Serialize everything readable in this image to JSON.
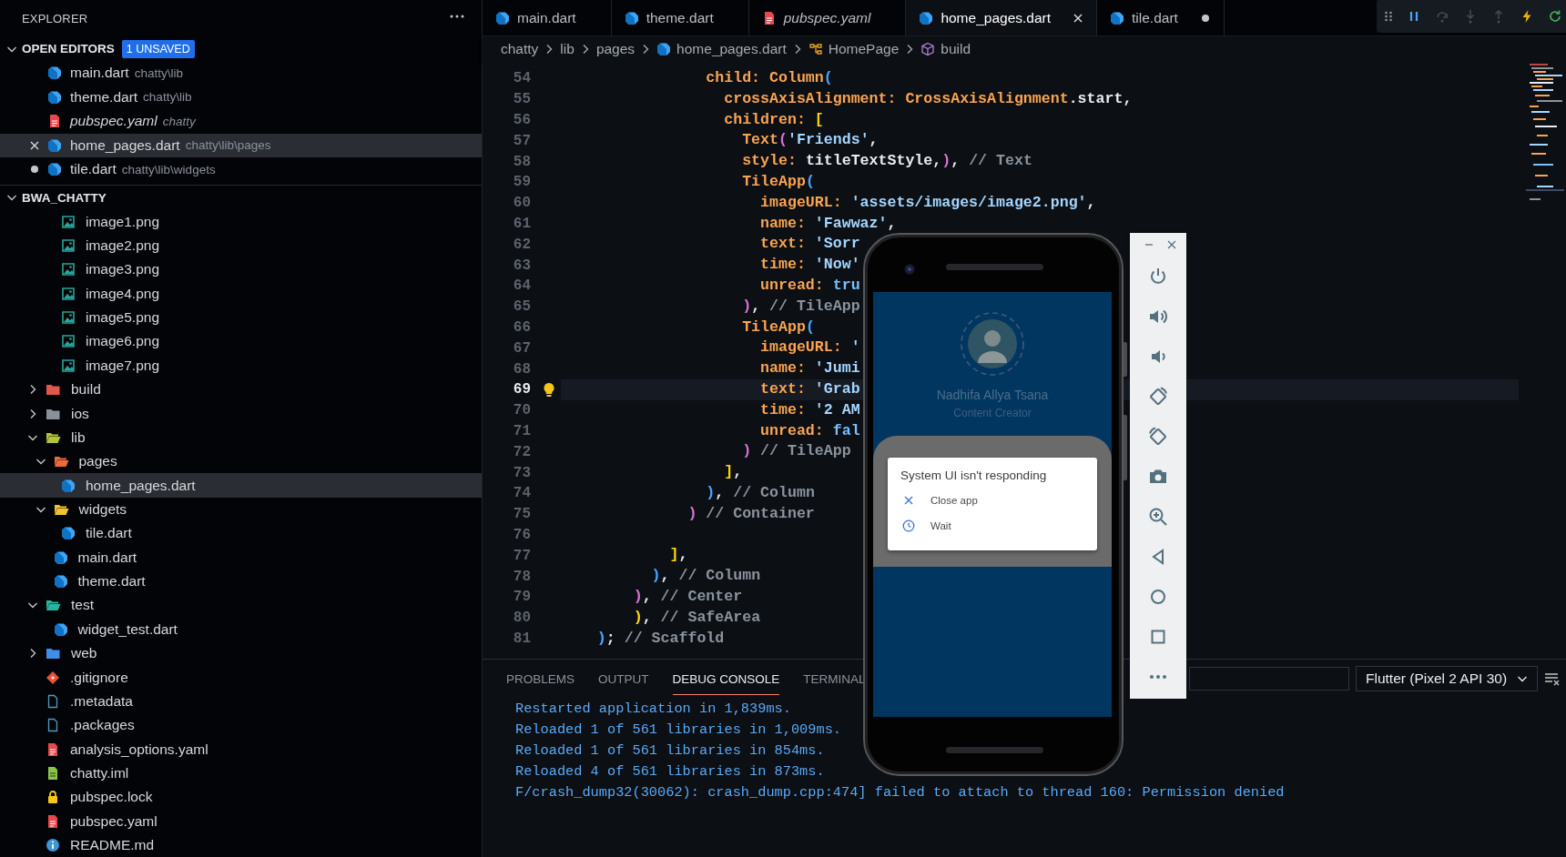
{
  "editor_tabs": [
    {
      "label": "main.dart",
      "kind": "dart",
      "selected": false,
      "preview": false,
      "dirty": false
    },
    {
      "label": "theme.dart",
      "kind": "dart",
      "selected": false,
      "preview": false,
      "dirty": false
    },
    {
      "label": "pubspec.yaml",
      "kind": "yaml",
      "selected": false,
      "preview": true,
      "dirty": false
    },
    {
      "label": "home_pages.dart",
      "kind": "dart",
      "selected": true,
      "preview": false,
      "dirty": false
    },
    {
      "label": "tile.dart",
      "kind": "dart",
      "selected": false,
      "preview": false,
      "dirty": true
    }
  ],
  "debug_toolbar": {
    "buttons": [
      {
        "disabled": false
      },
      {
        "disabled": true
      },
      {
        "disabled": true
      },
      {
        "disabled": true
      },
      {
        "disabled": false
      },
      {
        "disabled": false
      }
    ]
  },
  "explorer": {
    "title": "EXPLORER",
    "open_editors": {
      "title": "OPEN EDITORS",
      "badge": "1 UNSAVED",
      "expanded": true,
      "items": [
        {
          "name": "main.dart",
          "path": "chatty\\lib",
          "kind": "dart",
          "selected": false,
          "preview": false,
          "dirty": false
        },
        {
          "name": "theme.dart",
          "path": "chatty\\lib",
          "kind": "dart",
          "selected": false,
          "preview": false,
          "dirty": false
        },
        {
          "name": "pubspec.yaml",
          "path": "chatty",
          "kind": "yaml",
          "selected": false,
          "preview": true,
          "dirty": false
        },
        {
          "name": "home_pages.dart",
          "path": "chatty\\lib\\pages",
          "kind": "dart",
          "selected": true,
          "preview": false,
          "dirty": false
        },
        {
          "name": "tile.dart",
          "path": "chatty\\lib\\widgets",
          "kind": "dart",
          "selected": false,
          "preview": false,
          "dirty": true
        }
      ]
    },
    "project": {
      "title": "BWA_CHATTY",
      "expanded": true,
      "tree": [
        {
          "children": [
            {
              "children": [
                {
                  "name": "image1.png",
                  "kind": "image",
                  "selected": false
                },
                {
                  "name": "image2.png",
                  "kind": "image",
                  "selected": false
                },
                {
                  "name": "image3.png",
                  "kind": "image",
                  "selected": false
                },
                {
                  "name": "image4.png",
                  "kind": "image",
                  "selected": false
                },
                {
                  "name": "image5.png",
                  "kind": "image",
                  "selected": false
                },
                {
                  "name": "image6.png",
                  "kind": "image",
                  "selected": false
                },
                {
                  "name": "image7.png",
                  "kind": "image",
                  "selected": false
                }
              ]
            }
          ]
        },
        {
          "name": "build",
          "kind": "folder",
          "color": "#e2574c",
          "expanded": false,
          "selected": false
        },
        {
          "name": "ios",
          "kind": "folder",
          "color": "#8a9099",
          "expanded": false,
          "selected": false
        },
        {
          "name": "lib",
          "kind": "folder",
          "color": "#b4c43a",
          "expanded": true,
          "selected": false,
          "children": [
            {
              "name": "pages",
              "kind": "folder",
              "color": "#ee6a3c",
              "expanded": true,
              "selected": false,
              "children": [
                {
                  "name": "home_pages.dart",
                  "kind": "dart",
                  "selected": true
                }
              ]
            },
            {
              "name": "widgets",
              "kind": "folder",
              "color": "#f2c230",
              "expanded": true,
              "selected": false,
              "children": [
                {
                  "name": "tile.dart",
                  "kind": "dart",
                  "selected": false
                }
              ]
            },
            {
              "name": "main.dart",
              "kind": "dart",
              "selected": false
            },
            {
              "name": "theme.dart",
              "kind": "dart",
              "selected": false
            }
          ]
        },
        {
          "name": "test",
          "kind": "folder",
          "color": "#26b59e",
          "expanded": true,
          "selected": false,
          "children": [
            {
              "name": "widget_test.dart",
              "kind": "dart",
              "selected": false
            }
          ]
        },
        {
          "name": "web",
          "kind": "folder",
          "color": "#3d8fe8",
          "expanded": false,
          "selected": false
        },
        {
          "name": ".gitignore",
          "kind": "git",
          "selected": false
        },
        {
          "name": ".metadata",
          "kind": "file",
          "selected": false
        },
        {
          "name": ".packages",
          "kind": "file",
          "selected": false
        },
        {
          "name": "analysis_options.yaml",
          "kind": "yaml",
          "selected": false
        },
        {
          "name": "chatty.iml",
          "kind": "iml",
          "selected": false
        },
        {
          "name": "pubspec.lock",
          "kind": "lock",
          "selected": false
        },
        {
          "name": "pubspec.yaml",
          "kind": "yaml",
          "selected": false
        },
        {
          "name": "README.md",
          "kind": "info",
          "selected": false
        }
      ]
    }
  },
  "breadcrumb": [
    {
      "label": "chatty"
    },
    {
      "label": "lib"
    },
    {
      "label": "pages"
    },
    {
      "label": "home_pages.dart",
      "kind": "dart"
    },
    {
      "label": "HomePage",
      "kind": "class"
    },
    {
      "label": "build",
      "kind": "method"
    }
  ],
  "code_lines": [
    {
      "number": "54",
      "current": false,
      "tokens": [
        {
          "kind": "k",
          "text": "                child: Column"
        },
        {
          "kind": "b",
          "text": "("
        }
      ]
    },
    {
      "number": "55",
      "current": false,
      "tokens": [
        {
          "kind": "k",
          "text": "                  crossAxisAlignment: CrossAxisAlignment"
        },
        {
          "kind": "t",
          "text": ".start,"
        }
      ]
    },
    {
      "number": "56",
      "current": false,
      "tokens": [
        {
          "kind": "k",
          "text": "                  children: "
        },
        {
          "kind": "y",
          "text": "["
        }
      ]
    },
    {
      "number": "57",
      "current": false,
      "tokens": [
        {
          "kind": "k",
          "text": "                    Text"
        },
        {
          "kind": "m",
          "text": "("
        },
        {
          "kind": "s",
          "text": "'Friends'"
        },
        {
          "kind": "t",
          "text": ","
        }
      ]
    },
    {
      "number": "58",
      "current": false,
      "tokens": [
        {
          "kind": "k",
          "text": "                    style: "
        },
        {
          "kind": "t",
          "text": "titleTextStyle,"
        },
        {
          "kind": "m",
          "text": ")"
        },
        {
          "kind": "t",
          "text": ","
        },
        {
          "kind": "c",
          "text": " // Text"
        }
      ]
    },
    {
      "number": "59",
      "current": false,
      "tokens": [
        {
          "kind": "k",
          "text": "                    TileApp"
        },
        {
          "kind": "b",
          "text": "("
        }
      ]
    },
    {
      "number": "60",
      "current": false,
      "tokens": [
        {
          "kind": "k",
          "text": "                      imageURL: "
        },
        {
          "kind": "s",
          "text": "'assets/images/image2.png'"
        },
        {
          "kind": "t",
          "text": ","
        }
      ]
    },
    {
      "number": "61",
      "current": false,
      "tokens": [
        {
          "kind": "k",
          "text": "                      name: "
        },
        {
          "kind": "s",
          "text": "'Fawwaz'"
        },
        {
          "kind": "t",
          "text": ","
        }
      ]
    },
    {
      "number": "62",
      "current": false,
      "tokens": [
        {
          "kind": "k",
          "text": "                      text: "
        },
        {
          "kind": "s",
          "text": "'Sorr"
        }
      ]
    },
    {
      "number": "63",
      "current": false,
      "tokens": [
        {
          "kind": "k",
          "text": "                      time: "
        },
        {
          "kind": "s",
          "text": "'Now'"
        }
      ]
    },
    {
      "number": "64",
      "current": false,
      "tokens": [
        {
          "kind": "k",
          "text": "                      unread: "
        },
        {
          "kind": "l",
          "text": "tru"
        }
      ]
    },
    {
      "number": "65",
      "current": false,
      "tokens": [
        {
          "kind": "m",
          "text": "                    )"
        },
        {
          "kind": "t",
          "text": ","
        },
        {
          "kind": "c",
          "text": " // TileApp"
        }
      ]
    },
    {
      "number": "66",
      "current": false,
      "tokens": [
        {
          "kind": "k",
          "text": "                    TileApp"
        },
        {
          "kind": "b",
          "text": "("
        }
      ]
    },
    {
      "number": "67",
      "current": false,
      "tokens": [
        {
          "kind": "k",
          "text": "                      imageURL: "
        },
        {
          "kind": "s",
          "text": "'"
        }
      ]
    },
    {
      "number": "68",
      "current": false,
      "tokens": [
        {
          "kind": "k",
          "text": "                      name: "
        },
        {
          "kind": "s",
          "text": "'Jumi"
        }
      ]
    },
    {
      "number": "69",
      "current": true,
      "tokens": [
        {
          "kind": "k",
          "text": "                      text: "
        },
        {
          "kind": "s",
          "text": "'Grab"
        }
      ]
    },
    {
      "number": "70",
      "current": false,
      "tokens": [
        {
          "kind": "k",
          "text": "                      time: "
        },
        {
          "kind": "s",
          "text": "'2 AM"
        }
      ]
    },
    {
      "number": "71",
      "current": false,
      "tokens": [
        {
          "kind": "k",
          "text": "                      unread: "
        },
        {
          "kind": "l",
          "text": "fal"
        }
      ]
    },
    {
      "number": "72",
      "current": false,
      "tokens": [
        {
          "kind": "m",
          "text": "                    )"
        },
        {
          "kind": "c",
          "text": " // TileApp"
        }
      ]
    },
    {
      "number": "73",
      "current": false,
      "tokens": [
        {
          "kind": "y",
          "text": "                  ]"
        },
        {
          "kind": "t",
          "text": ","
        }
      ]
    },
    {
      "number": "74",
      "current": false,
      "tokens": [
        {
          "kind": "b",
          "text": "                )"
        },
        {
          "kind": "t",
          "text": ","
        },
        {
          "kind": "c",
          "text": " // Column"
        }
      ]
    },
    {
      "number": "75",
      "current": false,
      "tokens": [
        {
          "kind": "m",
          "text": "              )"
        },
        {
          "kind": "c",
          "text": " // Container"
        }
      ]
    },
    {
      "number": "76",
      "current": false
    },
    {
      "number": "77",
      "current": false,
      "tokens": [
        {
          "kind": "y",
          "text": "            ]"
        },
        {
          "kind": "t",
          "text": ","
        }
      ]
    },
    {
      "number": "78",
      "current": false,
      "tokens": [
        {
          "kind": "b",
          "text": "          )"
        },
        {
          "kind": "t",
          "text": ","
        },
        {
          "kind": "c",
          "text": " // Column"
        }
      ]
    },
    {
      "number": "79",
      "current": false,
      "tokens": [
        {
          "kind": "m",
          "text": "        )"
        },
        {
          "kind": "t",
          "text": ","
        },
        {
          "kind": "c",
          "text": " // Center"
        }
      ]
    },
    {
      "number": "80",
      "current": false,
      "tokens": [
        {
          "kind": "y",
          "text": "        )"
        },
        {
          "kind": "t",
          "text": ","
        },
        {
          "kind": "c",
          "text": " // SafeArea"
        }
      ]
    },
    {
      "number": "81",
      "current": false,
      "tokens": [
        {
          "kind": "b",
          "text": "    )"
        },
        {
          "kind": "t",
          "text": ";"
        },
        {
          "kind": "c",
          "text": " // Scaffold"
        }
      ]
    }
  ],
  "panel": {
    "tabs": [
      {
        "label": "PROBLEMS",
        "selected": false
      },
      {
        "label": "OUTPUT",
        "selected": false
      },
      {
        "label": "DEBUG CONSOLE",
        "selected": true
      },
      {
        "label": "TERMINAL",
        "selected": false
      }
    ],
    "session": "Flutter (Pixel 2 API 30)",
    "lines": [
      "Restarted application in 1,839ms.",
      "Reloaded 1 of 561 libraries in 1,009ms.",
      "Reloaded 1 of 561 libraries in 854ms.",
      "Reloaded 4 of 561 libraries in 873ms.",
      "F/crash_dump32(30062): crash_dump.cpp:474] failed to attach to thread 160: Permission denied"
    ]
  },
  "emulator": {
    "profile": {
      "name": "Nadhifa Allya Tsana",
      "role": "Content Creator"
    },
    "dialog": {
      "title": "System UI isn't responding",
      "options": [
        {
          "label": "Close app",
          "kind": "close"
        },
        {
          "label": "Wait",
          "kind": "clock"
        }
      ]
    }
  }
}
